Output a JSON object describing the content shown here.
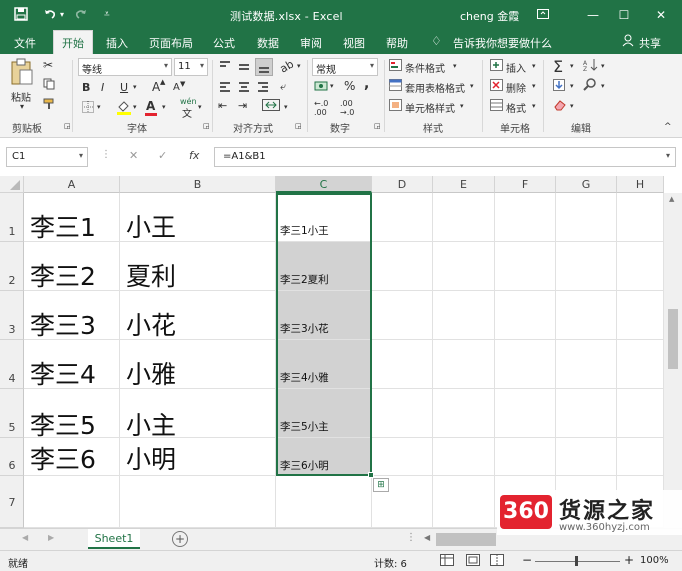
{
  "titlebar": {
    "title": "测试数据.xlsx  -  Excel",
    "user": "cheng 金霞",
    "save_icon": "save-icon",
    "undo_icon": "undo-icon",
    "redo_icon": "redo-icon",
    "customize_icon": "customize-icon"
  },
  "menu": {
    "tabs": [
      "文件",
      "开始",
      "插入",
      "页面布局",
      "公式",
      "数据",
      "审阅",
      "视图",
      "帮助"
    ],
    "tellme": "告诉我你想要做什么",
    "share": "共享"
  },
  "ribbon": {
    "paste": "粘贴",
    "clipboard": "剪贴板",
    "font_name": "等线",
    "font_size": "11",
    "font_group": "字体",
    "bold": "B",
    "italic": "I",
    "underline": "U",
    "grow_font": "A",
    "shrink_font": "A",
    "wen": "wén",
    "align_group": "对齐方式",
    "number_format": "常规",
    "percent": "%",
    "comma": ",",
    "number_group": "数字",
    "cond_format": "条件格式",
    "table_format": "套用表格格式",
    "cell_style": "单元格样式",
    "style_group": "样式",
    "insert": "插入",
    "delete": "删除",
    "format": "格式",
    "cells_group": "单元格",
    "sum": "Σ",
    "edit_group": "编辑"
  },
  "formula": {
    "namebox": "C1",
    "fx": "fx",
    "value": "=A1&B1"
  },
  "columns": [
    "A",
    "B",
    "C",
    "D",
    "E",
    "F",
    "G",
    "H"
  ],
  "rows": [
    {
      "num": "1",
      "a": "李三1",
      "b": "小王",
      "c": "李三1小王"
    },
    {
      "num": "2",
      "a": "李三2",
      "b": "夏利",
      "c": "李三2夏利"
    },
    {
      "num": "3",
      "a": "李三3",
      "b": "小花",
      "c": "李三3小花"
    },
    {
      "num": "4",
      "a": "李三4",
      "b": "小雅",
      "c": "李三4小雅"
    },
    {
      "num": "5",
      "a": "李三5",
      "b": "小主",
      "c": "李三5小主"
    },
    {
      "num": "6",
      "a": "李三6",
      "b": "小明",
      "c": "李三6小明"
    },
    {
      "num": "7",
      "a": "",
      "b": "",
      "c": ""
    }
  ],
  "sheets": {
    "active": "Sheet1",
    "add": "+"
  },
  "status": {
    "ready": "就绪",
    "count": "计数: 6",
    "zoom": "100%",
    "minus": "−",
    "plus": "+"
  },
  "watermark": {
    "badge": "360",
    "title": "货源之家",
    "url": "www.360hyzj.com"
  },
  "colors": {
    "excel_green": "#217346",
    "selection_gray": "#d2d2d2",
    "watermark_red": "#e3232f"
  }
}
